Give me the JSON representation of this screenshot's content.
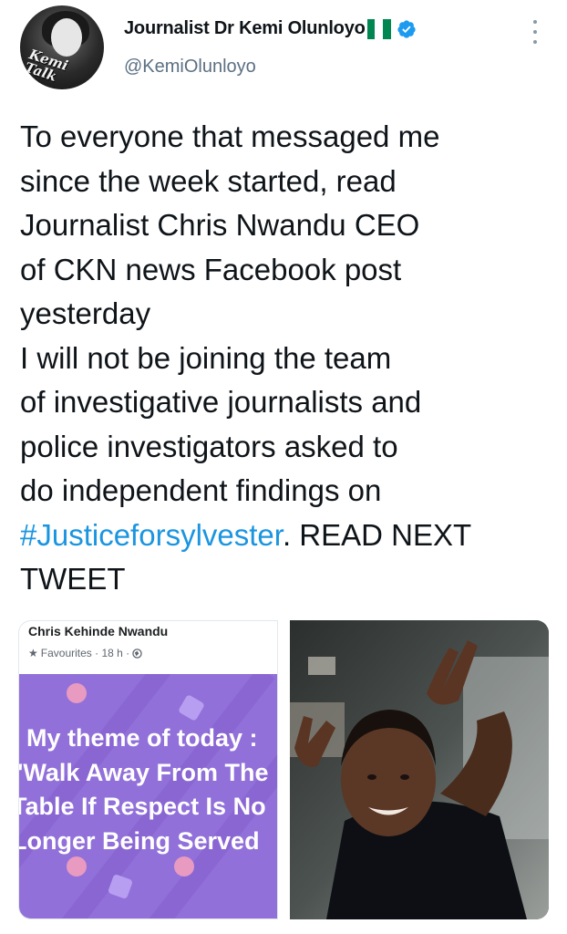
{
  "author": {
    "display_name": "Journalist Dr Kemi Olunloyo",
    "handle": "@KemiOlunloyo",
    "avatar_logo_text": "Kemi Talk",
    "flag_icon": "nigeria-flag-icon",
    "verified_icon": "verified-badge-icon"
  },
  "tweet": {
    "lines": [
      "To everyone that messaged me",
      "since the week started, read",
      "Journalist Chris Nwandu CEO",
      "of CKN news Facebook post",
      "yesterday",
      "I will not be joining the team",
      "of investigative journalists and",
      "police investigators asked to",
      "do independent findings on"
    ],
    "hashtag": "#Justiceforsylvester",
    "after_hashtag": ". READ NEXT",
    "last_line": "TWEET"
  },
  "media": {
    "left": {
      "poster_name": "Chris Kehinde Nwandu",
      "meta_star_icon": "star-icon",
      "meta_text": "Favourites · 18 h ·",
      "meta_globe_icon": "globe-icon",
      "quote_lines": [
        "My theme of today :",
        "'Walk Away From The",
        "Table If Respect Is No",
        "Longer Being Served"
      ]
    },
    "right": {
      "description_icon": "photo-boy-peace-sign"
    }
  },
  "colors": {
    "accent_link": "#1b95e0",
    "verified_blue": "#1d9bf0",
    "secondary_text": "#5b7083",
    "fb_card_purple": "#9170d9",
    "flag_green": "#008751"
  }
}
